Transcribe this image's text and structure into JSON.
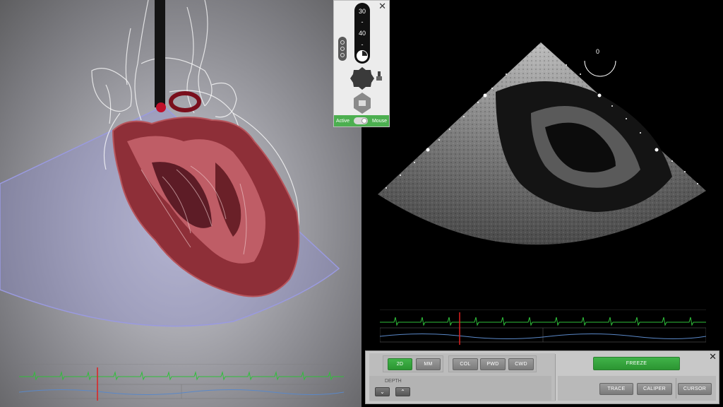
{
  "probe_panel": {
    "angle_top": "30",
    "angle_bottom": "40",
    "dash": "-",
    "mode_left": "Active",
    "mode_right": "Mouse",
    "close_symbol": "✕"
  },
  "ultrasound": {
    "angle_value": "0"
  },
  "controls": {
    "close_symbol": "✕",
    "mode_buttons": [
      "2D",
      "MM"
    ],
    "doppler_buttons": [
      "COL",
      "PWD",
      "CWD"
    ],
    "depth_label": "DEPTH",
    "depth_down": "⌄",
    "depth_up": "⌃",
    "freeze_label": "FREEZE",
    "tools": [
      "TRACE",
      "CALIPER",
      "CURSOR"
    ]
  },
  "colors": {
    "active_green": "#41b349",
    "ecg_green": "#2fbf3a",
    "resp_blue": "#5a88c8",
    "marker_red": "#e02020",
    "sector_blue": "#8f8fd8"
  }
}
